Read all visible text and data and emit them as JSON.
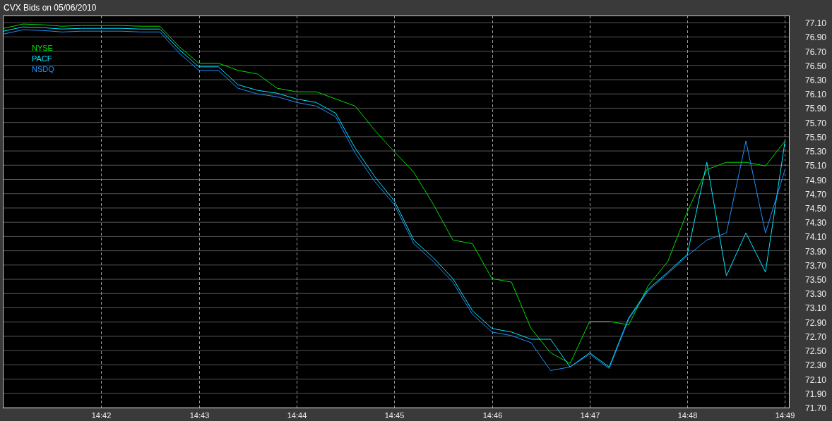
{
  "window": {
    "title": "CVX Bids on 05/06/2010"
  },
  "chart": {
    "chart_data": {
      "type": "line",
      "categories": [
        null,
        null,
        null,
        null,
        null,
        "14:42",
        null,
        null,
        null,
        null,
        "14:43",
        null,
        null,
        null,
        null,
        "14:44",
        null,
        null,
        null,
        null,
        "14:45",
        null,
        null,
        null,
        null,
        "14:46",
        null,
        null,
        null,
        null,
        "14:47",
        null,
        null,
        null,
        null,
        "14:48",
        null,
        null,
        null,
        null,
        "14:49"
      ],
      "series": [
        {
          "name": "NYSE",
          "color": "#00e000",
          "values": [
            77.02,
            77.08,
            77.07,
            77.05,
            77.06,
            77.06,
            77.06,
            77.05,
            77.05,
            76.76,
            76.53,
            76.53,
            76.43,
            76.38,
            76.18,
            76.13,
            76.13,
            76.03,
            75.93,
            75.59,
            75.29,
            75.0,
            74.55,
            74.05,
            74.0,
            73.51,
            73.46,
            72.81,
            72.47,
            72.32,
            72.91,
            72.91,
            72.86,
            73.41,
            73.75,
            74.45,
            75.04,
            75.14,
            75.14,
            75.09,
            75.44
          ]
        },
        {
          "name": "PACF",
          "color": "#00e8ff",
          "values": [
            76.98,
            77.04,
            77.03,
            77.01,
            77.02,
            77.02,
            77.02,
            77.01,
            77.01,
            76.72,
            76.48,
            76.48,
            76.23,
            76.15,
            76.11,
            76.03,
            75.98,
            75.83,
            75.34,
            74.94,
            74.6,
            74.05,
            73.8,
            73.51,
            73.06,
            72.81,
            72.76,
            72.66,
            72.66,
            72.27,
            72.47,
            72.27,
            72.96,
            73.36,
            73.6,
            73.85,
            75.14,
            73.55,
            74.15,
            73.6,
            75.44
          ]
        },
        {
          "name": "NSDQ",
          "color": "#1e90ff",
          "values": [
            76.94,
            77.0,
            76.99,
            76.97,
            76.98,
            76.98,
            76.98,
            76.97,
            76.97,
            76.67,
            76.43,
            76.43,
            76.18,
            76.1,
            76.06,
            75.98,
            75.93,
            75.78,
            75.27,
            74.87,
            74.55,
            74.0,
            73.75,
            73.46,
            73.01,
            72.76,
            72.71,
            72.61,
            72.22,
            72.27,
            72.45,
            72.25,
            72.94,
            73.34,
            73.58,
            73.83,
            74.05,
            74.15,
            75.44,
            74.15,
            75.04
          ]
        }
      ],
      "ylim": [
        71.7,
        77.2
      ],
      "grid": true,
      "yticks": [
        {
          "value": 77.1,
          "label": "77.10"
        },
        {
          "value": 76.9,
          "label": "76.90"
        },
        {
          "value": 76.7,
          "label": "76.70"
        },
        {
          "value": 76.5,
          "label": "76.50"
        },
        {
          "value": 76.3,
          "label": "76.30"
        },
        {
          "value": 76.1,
          "label": "76.10"
        },
        {
          "value": 75.9,
          "label": "75.90"
        },
        {
          "value": 75.7,
          "label": "75.70"
        },
        {
          "value": 75.5,
          "label": "75.50"
        },
        {
          "value": 75.3,
          "label": "75.30"
        },
        {
          "value": 75.1,
          "label": "75.10"
        },
        {
          "value": 74.9,
          "label": "74.90"
        },
        {
          "value": 74.7,
          "label": "74.70"
        },
        {
          "value": 74.5,
          "label": "74.50"
        },
        {
          "value": 74.3,
          "label": "74.30"
        },
        {
          "value": 74.1,
          "label": "74.10"
        },
        {
          "value": 73.9,
          "label": "73.90"
        },
        {
          "value": 73.7,
          "label": "73.70"
        },
        {
          "value": 73.5,
          "label": "73.50"
        },
        {
          "value": 73.3,
          "label": "73.30"
        },
        {
          "value": 73.1,
          "label": "73.10"
        },
        {
          "value": 72.9,
          "label": "72.90"
        },
        {
          "value": 72.7,
          "label": "72.70"
        },
        {
          "value": 72.5,
          "label": "72.50"
        },
        {
          "value": 72.3,
          "label": "72.30"
        },
        {
          "value": 72.1,
          "label": "72.10"
        },
        {
          "value": 71.9,
          "label": "71.90"
        },
        {
          "value": 71.7,
          "label": "71.70"
        }
      ]
    }
  }
}
